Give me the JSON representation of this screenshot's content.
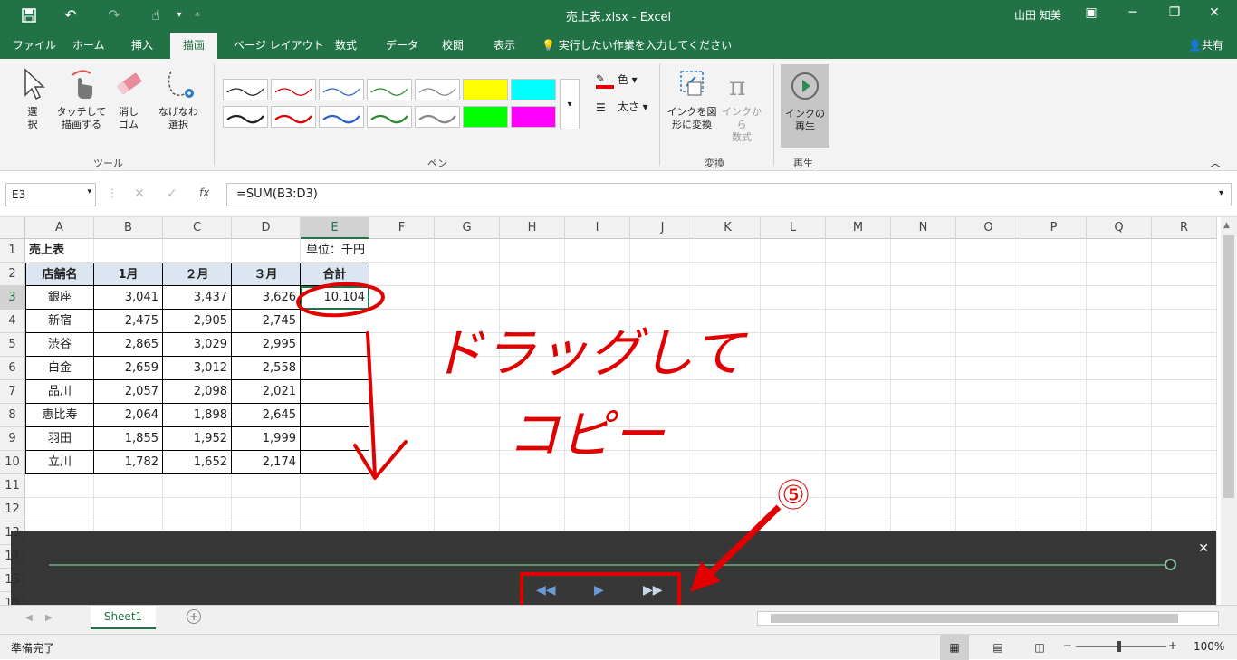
{
  "titlebar": {
    "title": "売上表.xlsx  -  Excel",
    "user": "山田 知美",
    "save_icon": "save-icon",
    "undo_icon": "undo-icon",
    "redo_icon": "redo-icon",
    "touch_icon": "touch-mode-icon"
  },
  "tabs": [
    "ファイル",
    "ホーム",
    "挿入",
    "描画",
    "ページ レイアウト",
    "数式",
    "データ",
    "校閲",
    "表示"
  ],
  "active_tab": "描画",
  "tell_me": "実行したい作業を入力してください",
  "share": "共有",
  "ribbon": {
    "tools": {
      "select": "選\n択",
      "touch_draw": "タッチして\n描画する",
      "eraser": "消し\nゴム",
      "lasso": "なげなわ\n選択",
      "label": "ツール"
    },
    "pens_label": "ペン",
    "color_label": "色",
    "thickness_label": "太さ",
    "convert": {
      "ink_to_shape": "インクを図\n形に変換",
      "ink_to_math": "インクから\n数式",
      "label": "変換"
    },
    "replay": {
      "ink_replay": "インクの\n再生",
      "label": "再生"
    }
  },
  "formula_bar": {
    "name_box": "E3",
    "formula": "=SUM(B3:D3)",
    "fx": "fx"
  },
  "columns": [
    "A",
    "B",
    "C",
    "D",
    "E",
    "F",
    "G",
    "H",
    "I",
    "J",
    "K",
    "L",
    "M",
    "N",
    "O",
    "P",
    "Q",
    "R"
  ],
  "rows": [
    "1",
    "2",
    "3",
    "4",
    "5",
    "6",
    "7",
    "8",
    "9",
    "10",
    "11",
    "12",
    "13",
    "14",
    "15",
    "16"
  ],
  "sheet": {
    "title": "売上表",
    "unit": "単位：千円",
    "headers": [
      "店舗名",
      "1月",
      "２月",
      "３月",
      "合計"
    ],
    "data": [
      [
        "銀座",
        "3,041",
        "3,437",
        "3,626",
        "10,104"
      ],
      [
        "新宿",
        "2,475",
        "2,905",
        "2,745",
        ""
      ],
      [
        "渋谷",
        "2,865",
        "3,029",
        "2,995",
        ""
      ],
      [
        "白金",
        "2,659",
        "3,012",
        "2,558",
        ""
      ],
      [
        "品川",
        "2,057",
        "2,098",
        "2,021",
        ""
      ],
      [
        "恵比寿",
        "2,064",
        "1,898",
        "2,645",
        ""
      ],
      [
        "羽田",
        "1,855",
        "1,952",
        "1,999",
        ""
      ],
      [
        "立川",
        "1,782",
        "1,652",
        "2,174",
        ""
      ]
    ]
  },
  "annotations": {
    "line1": "ドラッグして",
    "line2": "コピー",
    "step": "⑤"
  },
  "sheet_tabs": [
    "Sheet1"
  ],
  "status": {
    "ready": "準備完了",
    "zoom": "100%"
  },
  "colors": {
    "excel_green": "#217346",
    "header_fill": "#dce6f1",
    "ink_red": "#e00000"
  }
}
